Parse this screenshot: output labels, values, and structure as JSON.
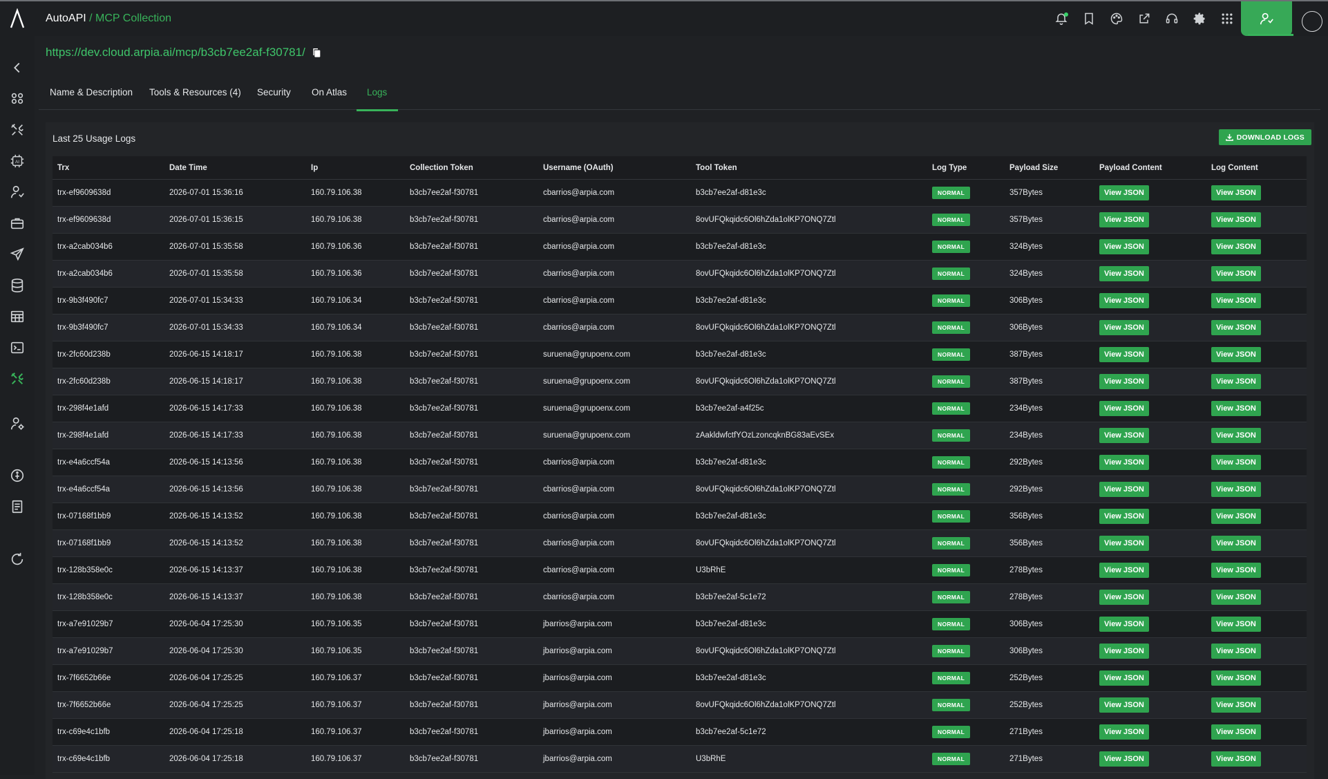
{
  "header": {
    "app_name": "AutoAPI",
    "separator": " / ",
    "current": "MCP Collection",
    "icons": [
      "bell-icon",
      "bookmark-icon",
      "palette-icon",
      "share-icon",
      "headset-icon",
      "gear-icon",
      "apps-grid-icon"
    ],
    "user_icon": "user-icon"
  },
  "sidebar": {
    "items": [
      "back-icon",
      "modules-icon",
      "tools-icon",
      "ai-chip-icon",
      "user-network-icon",
      "briefcase-icon",
      "send-icon",
      "database-icon",
      "table-icon",
      "terminal-icon",
      "autoapi-icon",
      "user-settings-icon",
      "help-icon",
      "document-icon",
      "refresh-icon"
    ],
    "active": "autoapi-icon"
  },
  "collection_url": "https://dev.cloud.arpia.ai/mcp/b3cb7ee2af-f30781/",
  "tabs": [
    {
      "label": "Name & Description"
    },
    {
      "label": "Tools & Resources (4)"
    },
    {
      "label": "Security"
    },
    {
      "label": "On Atlas"
    },
    {
      "label": "Logs"
    }
  ],
  "active_tab": "Logs",
  "logs": {
    "title": "Last 25 Usage Logs",
    "download_label": "DOWNLOAD LOGS",
    "columns": [
      "Trx",
      "Date Time",
      "Ip",
      "Collection Token",
      "Username (OAuth)",
      "Tool Token",
      "Log Type",
      "Payload Size",
      "Payload Content",
      "Log Content"
    ],
    "view_label": "View JSON",
    "rows": [
      {
        "trx": "trx-ef9609638d",
        "datetime": "2026-07-01 15:36:16",
        "ip": "160.79.106.38",
        "collection_token": "b3cb7ee2af-f30781",
        "username": "cbarrios@arpia.com",
        "tool_token": "b3cb7ee2af-d81e3c",
        "log_type": "NORMAL",
        "payload_size": "357Bytes"
      },
      {
        "trx": "trx-ef9609638d",
        "datetime": "2026-07-01 15:36:15",
        "ip": "160.79.106.38",
        "collection_token": "b3cb7ee2af-f30781",
        "username": "cbarrios@arpia.com",
        "tool_token": "8ovUFQkqidc6Ol6hZda1olKP7ONQ7Ztl",
        "log_type": "NORMAL",
        "payload_size": "357Bytes"
      },
      {
        "trx": "trx-a2cab034b6",
        "datetime": "2026-07-01 15:35:58",
        "ip": "160.79.106.36",
        "collection_token": "b3cb7ee2af-f30781",
        "username": "cbarrios@arpia.com",
        "tool_token": "b3cb7ee2af-d81e3c",
        "log_type": "NORMAL",
        "payload_size": "324Bytes"
      },
      {
        "trx": "trx-a2cab034b6",
        "datetime": "2026-07-01 15:35:58",
        "ip": "160.79.106.36",
        "collection_token": "b3cb7ee2af-f30781",
        "username": "cbarrios@arpia.com",
        "tool_token": "8ovUFQkqidc6Ol6hZda1olKP7ONQ7Ztl",
        "log_type": "NORMAL",
        "payload_size": "324Bytes"
      },
      {
        "trx": "trx-9b3f490fc7",
        "datetime": "2026-07-01 15:34:33",
        "ip": "160.79.106.34",
        "collection_token": "b3cb7ee2af-f30781",
        "username": "cbarrios@arpia.com",
        "tool_token": "b3cb7ee2af-d81e3c",
        "log_type": "NORMAL",
        "payload_size": "306Bytes"
      },
      {
        "trx": "trx-9b3f490fc7",
        "datetime": "2026-07-01 15:34:33",
        "ip": "160.79.106.34",
        "collection_token": "b3cb7ee2af-f30781",
        "username": "cbarrios@arpia.com",
        "tool_token": "8ovUFQkqidc6Ol6hZda1olKP7ONQ7Ztl",
        "log_type": "NORMAL",
        "payload_size": "306Bytes"
      },
      {
        "trx": "trx-2fc60d238b",
        "datetime": "2026-06-15 14:18:17",
        "ip": "160.79.106.38",
        "collection_token": "b3cb7ee2af-f30781",
        "username": "suruena@grupoenx.com",
        "tool_token": "b3cb7ee2af-d81e3c",
        "log_type": "NORMAL",
        "payload_size": "387Bytes"
      },
      {
        "trx": "trx-2fc60d238b",
        "datetime": "2026-06-15 14:18:17",
        "ip": "160.79.106.38",
        "collection_token": "b3cb7ee2af-f30781",
        "username": "suruena@grupoenx.com",
        "tool_token": "8ovUFQkqidc6Ol6hZda1olKP7ONQ7Ztl",
        "log_type": "NORMAL",
        "payload_size": "387Bytes"
      },
      {
        "trx": "trx-298f4e1afd",
        "datetime": "2026-06-15 14:17:33",
        "ip": "160.79.106.38",
        "collection_token": "b3cb7ee2af-f30781",
        "username": "suruena@grupoenx.com",
        "tool_token": "b3cb7ee2af-a4f25c",
        "log_type": "NORMAL",
        "payload_size": "234Bytes"
      },
      {
        "trx": "trx-298f4e1afd",
        "datetime": "2026-06-15 14:17:33",
        "ip": "160.79.106.38",
        "collection_token": "b3cb7ee2af-f30781",
        "username": "suruena@grupoenx.com",
        "tool_token": "zAakldwfctfYOzLzoncqknBG83aEvSEx",
        "log_type": "NORMAL",
        "payload_size": "234Bytes"
      },
      {
        "trx": "trx-e4a6ccf54a",
        "datetime": "2026-06-15 14:13:56",
        "ip": "160.79.106.38",
        "collection_token": "b3cb7ee2af-f30781",
        "username": "cbarrios@arpia.com",
        "tool_token": "b3cb7ee2af-d81e3c",
        "log_type": "NORMAL",
        "payload_size": "292Bytes"
      },
      {
        "trx": "trx-e4a6ccf54a",
        "datetime": "2026-06-15 14:13:56",
        "ip": "160.79.106.38",
        "collection_token": "b3cb7ee2af-f30781",
        "username": "cbarrios@arpia.com",
        "tool_token": "8ovUFQkqidc6Ol6hZda1olKP7ONQ7Ztl",
        "log_type": "NORMAL",
        "payload_size": "292Bytes"
      },
      {
        "trx": "trx-07168f1bb9",
        "datetime": "2026-06-15 14:13:52",
        "ip": "160.79.106.38",
        "collection_token": "b3cb7ee2af-f30781",
        "username": "cbarrios@arpia.com",
        "tool_token": "b3cb7ee2af-d81e3c",
        "log_type": "NORMAL",
        "payload_size": "356Bytes"
      },
      {
        "trx": "trx-07168f1bb9",
        "datetime": "2026-06-15 14:13:52",
        "ip": "160.79.106.38",
        "collection_token": "b3cb7ee2af-f30781",
        "username": "cbarrios@arpia.com",
        "tool_token": "8ovUFQkqidc6Ol6hZda1olKP7ONQ7Ztl",
        "log_type": "NORMAL",
        "payload_size": "356Bytes"
      },
      {
        "trx": "trx-128b358e0c",
        "datetime": "2026-06-15 14:13:37",
        "ip": "160.79.106.38",
        "collection_token": "b3cb7ee2af-f30781",
        "username": "cbarrios@arpia.com",
        "tool_token": "U3bRhE",
        "log_type": "NORMAL",
        "payload_size": "278Bytes"
      },
      {
        "trx": "trx-128b358e0c",
        "datetime": "2026-06-15 14:13:37",
        "ip": "160.79.106.38",
        "collection_token": "b3cb7ee2af-f30781",
        "username": "cbarrios@arpia.com",
        "tool_token": "b3cb7ee2af-5c1e72",
        "log_type": "NORMAL",
        "payload_size": "278Bytes"
      },
      {
        "trx": "trx-a7e91029b7",
        "datetime": "2026-06-04 17:25:30",
        "ip": "160.79.106.35",
        "collection_token": "b3cb7ee2af-f30781",
        "username": "jbarrios@arpia.com",
        "tool_token": "b3cb7ee2af-d81e3c",
        "log_type": "NORMAL",
        "payload_size": "306Bytes"
      },
      {
        "trx": "trx-a7e91029b7",
        "datetime": "2026-06-04 17:25:30",
        "ip": "160.79.106.35",
        "collection_token": "b3cb7ee2af-f30781",
        "username": "jbarrios@arpia.com",
        "tool_token": "8ovUFQkqidc6Ol6hZda1olKP7ONQ7Ztl",
        "log_type": "NORMAL",
        "payload_size": "306Bytes"
      },
      {
        "trx": "trx-7f6652b66e",
        "datetime": "2026-06-04 17:25:25",
        "ip": "160.79.106.37",
        "collection_token": "b3cb7ee2af-f30781",
        "username": "jbarrios@arpia.com",
        "tool_token": "b3cb7ee2af-d81e3c",
        "log_type": "NORMAL",
        "payload_size": "252Bytes"
      },
      {
        "trx": "trx-7f6652b66e",
        "datetime": "2026-06-04 17:25:25",
        "ip": "160.79.106.37",
        "collection_token": "b3cb7ee2af-f30781",
        "username": "jbarrios@arpia.com",
        "tool_token": "8ovUFQkqidc6Ol6hZda1olKP7ONQ7Ztl",
        "log_type": "NORMAL",
        "payload_size": "252Bytes"
      },
      {
        "trx": "trx-c69e4c1bfb",
        "datetime": "2026-06-04 17:25:18",
        "ip": "160.79.106.37",
        "collection_token": "b3cb7ee2af-f30781",
        "username": "jbarrios@arpia.com",
        "tool_token": "b3cb7ee2af-5c1e72",
        "log_type": "NORMAL",
        "payload_size": "271Bytes"
      },
      {
        "trx": "trx-c69e4c1bfb",
        "datetime": "2026-06-04 17:25:18",
        "ip": "160.79.106.37",
        "collection_token": "b3cb7ee2af-f30781",
        "username": "jbarrios@arpia.com",
        "tool_token": "U3bRhE",
        "log_type": "NORMAL",
        "payload_size": "271Bytes"
      }
    ]
  },
  "colors": {
    "accent": "#38b35a",
    "button_green": "#2fa44f",
    "background": "#1f2124"
  }
}
